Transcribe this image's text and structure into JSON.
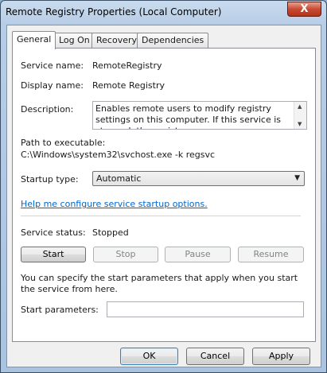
{
  "window": {
    "title": "Remote Registry Properties (Local Computer)",
    "close_glyph": "X"
  },
  "tabs": [
    {
      "label": "General",
      "active": true
    },
    {
      "label": "Log On",
      "active": false
    },
    {
      "label": "Recovery",
      "active": false
    },
    {
      "label": "Dependencies",
      "active": false
    }
  ],
  "general": {
    "service_name_label": "Service name:",
    "service_name_value": "RemoteRegistry",
    "display_name_label": "Display name:",
    "display_name_value": "Remote Registry",
    "description_label": "Description:",
    "description_value": "Enables remote users to modify registry settings on this computer. If this service is stopped, the registry",
    "path_label": "Path to executable:",
    "path_value": "C:\\Windows\\system32\\svchost.exe -k regsvc",
    "startup_type_label": "Startup type:",
    "startup_type_value": "Automatic",
    "help_link": "Help me configure service startup options.",
    "service_status_label": "Service status:",
    "service_status_value": "Stopped",
    "start_button": "Start",
    "stop_button": "Stop",
    "pause_button": "Pause",
    "resume_button": "Resume",
    "start_params_info": "You can specify the start parameters that apply when you start the service from here.",
    "start_params_label": "Start parameters:",
    "start_params_value": ""
  },
  "footer": {
    "ok_button": "OK",
    "cancel_button": "Cancel",
    "apply_button": "Apply"
  },
  "icons": {
    "scroll_up": "▲",
    "scroll_down": "▼",
    "dropdown": "▼"
  }
}
